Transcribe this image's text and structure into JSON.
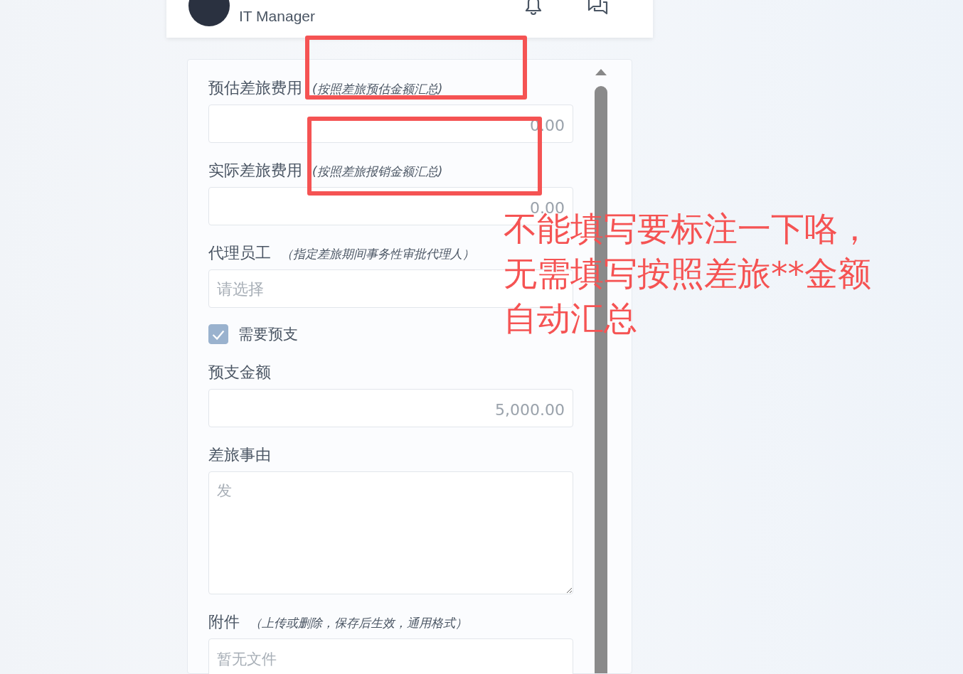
{
  "header": {
    "role": "IT Manager"
  },
  "form": {
    "fields": [
      {
        "kind": "number",
        "label": "预估差旅费用",
        "hint": "(按照差旅预估金额汇总)",
        "value": "0.00"
      },
      {
        "kind": "number",
        "label": "实际差旅费用",
        "hint": "(按照差旅报销金额汇总)",
        "value": "0.00"
      },
      {
        "kind": "select",
        "label": "代理员工",
        "hint": "（指定差旅期间事务性审批代理人）",
        "placeholder": "请选择"
      },
      {
        "kind": "checkbox",
        "label": "需要预支",
        "checked": true
      },
      {
        "kind": "number",
        "label": "预支金额",
        "value": "5,000.00"
      },
      {
        "kind": "textarea",
        "label": "差旅事由",
        "placeholder": "发"
      },
      {
        "kind": "files",
        "label": "附件",
        "hint": "（上传或删除，保存后生效，通用格式）",
        "placeholder": "暂无文件"
      }
    ]
  },
  "annotation": {
    "lines": [
      "不能填写要标注一下咯，",
      "无需填写按照差旅**金额",
      "自动汇总"
    ]
  }
}
